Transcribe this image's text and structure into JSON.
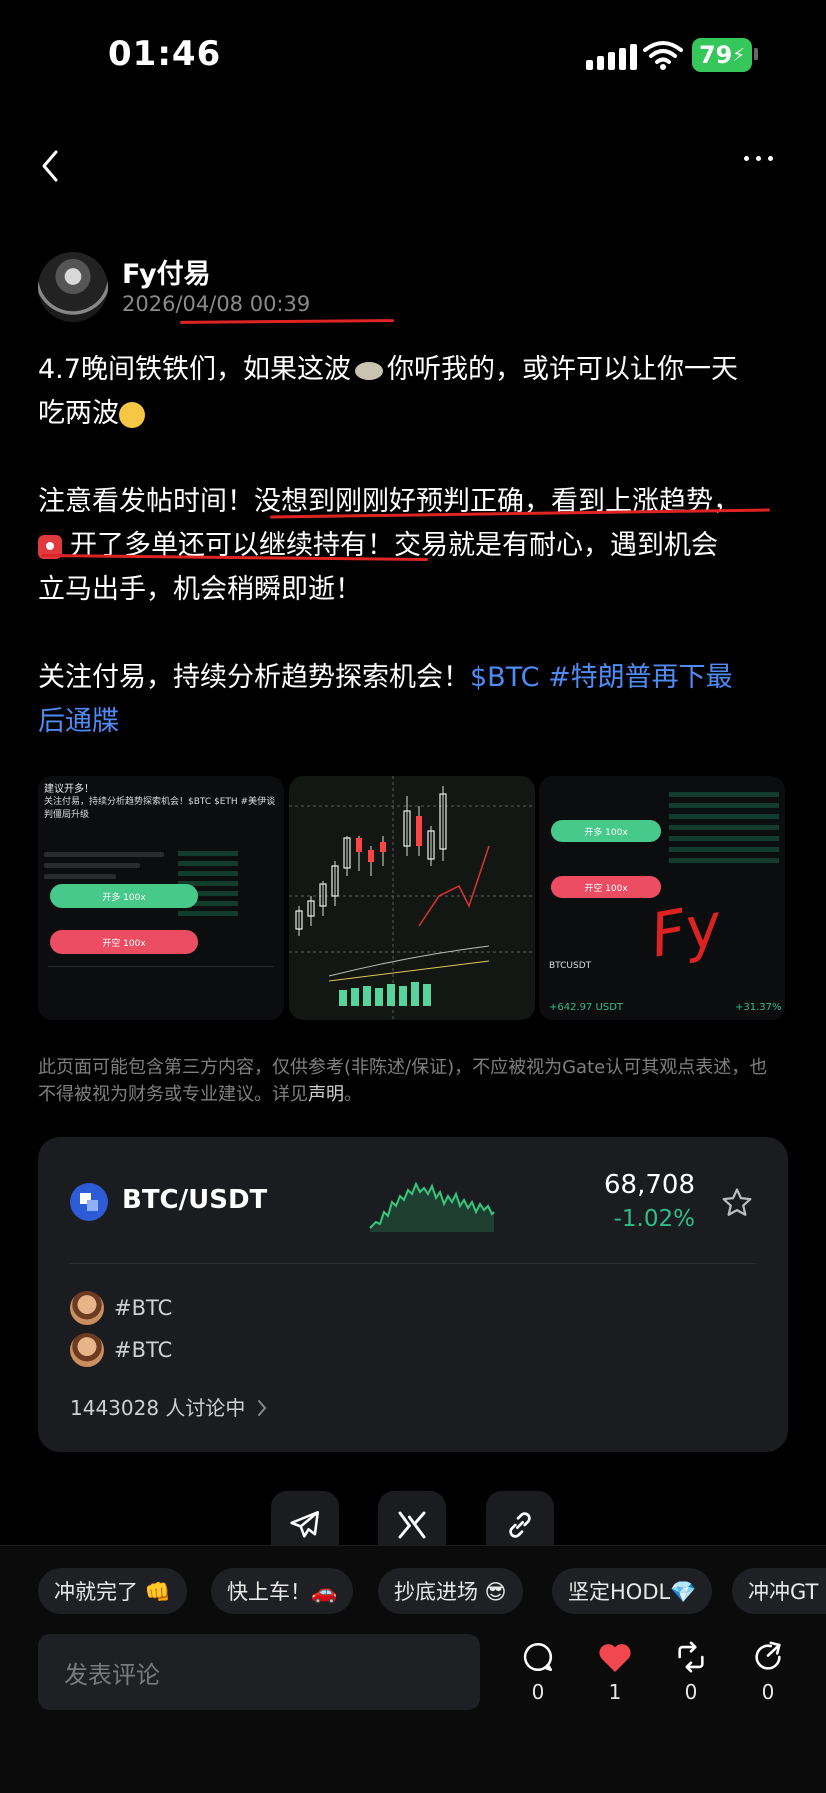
{
  "status_bar": {
    "time": "01:46",
    "battery": "79"
  },
  "author": {
    "name": "Fy付易",
    "date": "2026/04/08 00:39"
  },
  "post": {
    "line1": "4.7晚间铁铁们，如果这波",
    "line1b": "你听我的，或许可以让你一天",
    "line2": "吃两波",
    "line3": "注意看发帖时间！没想到刚刚好预判正确，看到上涨趋势，",
    "line4": "开了多单还可以继续持有！交易就是有耐心，遇到机会",
    "line5": "立马出手，机会稍瞬即逝！",
    "line6": "关注付易，持续分析趋势探索机会！",
    "tag1": "$BTC",
    "tag2": "#特朗普再下最",
    "tag2b": "后通牒"
  },
  "images": {
    "img1_title": "建议开多！",
    "img1_text": "关注付易，持续分析趋势探索机会！$BTC $ETH #美伊谈判僵局升级",
    "img1_long": "开多 100x",
    "img1_short": "开空 100x",
    "img3_long": "开多 100x",
    "img3_short": "开空 100x",
    "img3_pair": "BTCUSDT",
    "img3_pnl": "+642.97 USDT",
    "img3_pct": "+31.37%",
    "img3_signature": "Fy"
  },
  "disclaimer": {
    "text": "此页面可能包含第三方内容，仅供参考(非陈述/保证)，不应被视为Gate认可其观点表述，也不得被视为财务或专业建议。详见",
    "link": "声明",
    "tail": "。"
  },
  "market_card": {
    "pair": "BTC/USDT",
    "price": "68,708",
    "change": "-1.02%",
    "tags": [
      "#BTC",
      "#BTC"
    ],
    "discussion": "1443028 人讨论中"
  },
  "quick_replies": [
    "冲就完了 👊",
    "快上车！🚗",
    "抄底进场 😎",
    "坚定HODL💎",
    "冲冲GT"
  ],
  "comment_placeholder": "发表评论",
  "actions": {
    "comments": "0",
    "likes": "1",
    "reposts": "0",
    "shares": "0"
  },
  "colors": {
    "accent_blue": "#4f8bf5",
    "green": "#2ebd85",
    "red": "#e02424",
    "like_red": "#f0484e"
  },
  "icons": [
    "back-icon",
    "more-icon",
    "star-icon",
    "telegram-icon",
    "x-icon",
    "link-icon",
    "comment-icon",
    "heart-icon",
    "repost-icon",
    "share-icon"
  ]
}
